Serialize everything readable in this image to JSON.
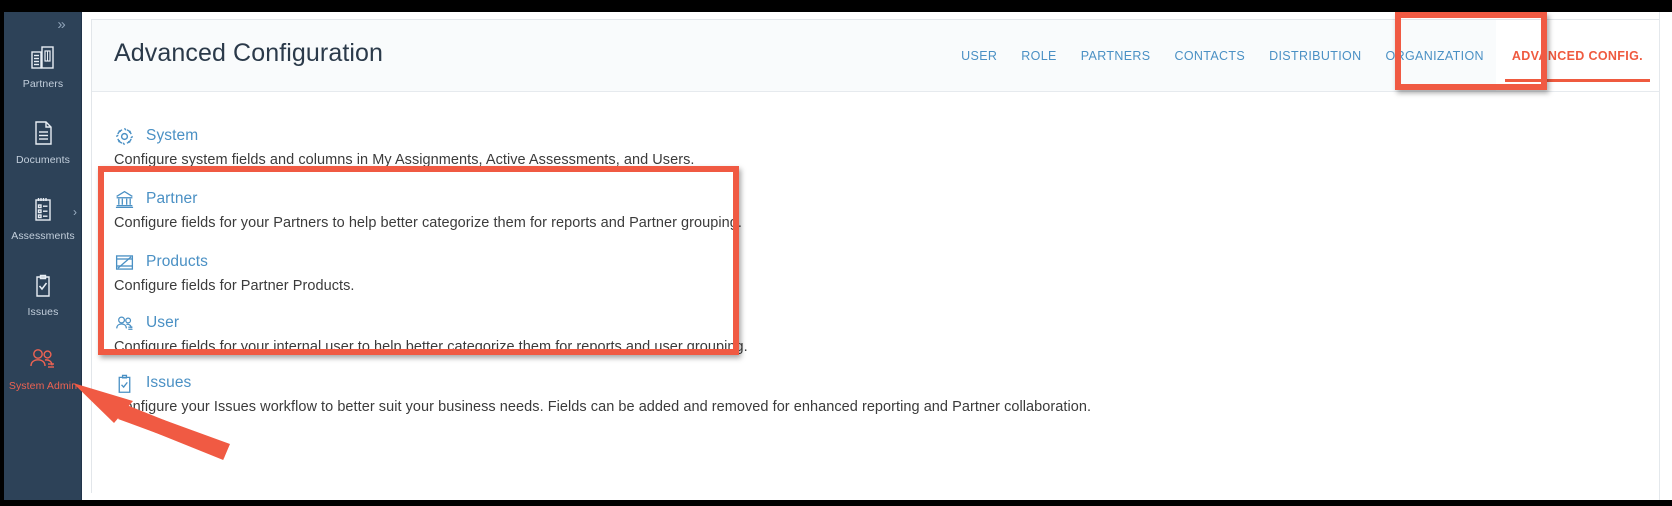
{
  "sidebar": {
    "collapse_icon": "chevron-double-right-icon",
    "collapse_glyph": "»",
    "items": [
      {
        "label": "Partners",
        "icon": "bank-building-icon",
        "active": false,
        "has_chevron": false
      },
      {
        "label": "Documents",
        "icon": "document-icon",
        "active": false,
        "has_chevron": false
      },
      {
        "label": "Assessments",
        "icon": "clipboard-list-icon",
        "active": false,
        "has_chevron": true
      },
      {
        "label": "Issues",
        "icon": "clipboard-check-icon",
        "active": false,
        "has_chevron": false
      },
      {
        "label": "System Admin",
        "icon": "users-icon",
        "active": true,
        "has_chevron": false
      }
    ]
  },
  "header": {
    "title": "Advanced Configuration",
    "tabs": [
      {
        "label": "USER",
        "active": false
      },
      {
        "label": "ROLE",
        "active": false
      },
      {
        "label": "PARTNERS",
        "active": false
      },
      {
        "label": "CONTACTS",
        "active": false
      },
      {
        "label": "DISTRIBUTION",
        "active": false
      },
      {
        "label": "ORGANIZATION",
        "active": false
      },
      {
        "label": "ADVANCED CONFIG.",
        "active": true
      }
    ]
  },
  "content": {
    "sections": [
      {
        "title": "System",
        "icon": "gear-icon",
        "description": "Configure system fields and columns in My Assignments, Active Assessments, and Users."
      },
      {
        "title": "Partner",
        "icon": "bank-columns-icon",
        "description": "Configure fields for your Partners to help better categorize them for reports and Partner grouping."
      },
      {
        "title": "Products",
        "icon": "products-box-icon",
        "description": "Configure fields for Partner Products."
      },
      {
        "title": "User",
        "icon": "users-icon",
        "description": "Configure fields for your internal user to help better categorize them for reports and user grouping."
      },
      {
        "title": "Issues",
        "icon": "clipboard-check-icon",
        "description": "Configure your Issues workflow to better suit your business needs. Fields can be added and removed for enhanced reporting and Partner collaboration."
      }
    ]
  },
  "annotations": {
    "highlight_color": "#f05a43",
    "boxes": [
      {
        "name": "advanced-config-tab-highlight"
      },
      {
        "name": "partner-products-user-group-highlight"
      }
    ],
    "arrow": {
      "name": "system-admin-pointer-arrow"
    }
  },
  "colors": {
    "sidebar_bg": "#2d4258",
    "accent_link": "#4a90c4",
    "accent_active": "#ef5a3f",
    "page_header_bg": "#f9fbfc"
  }
}
